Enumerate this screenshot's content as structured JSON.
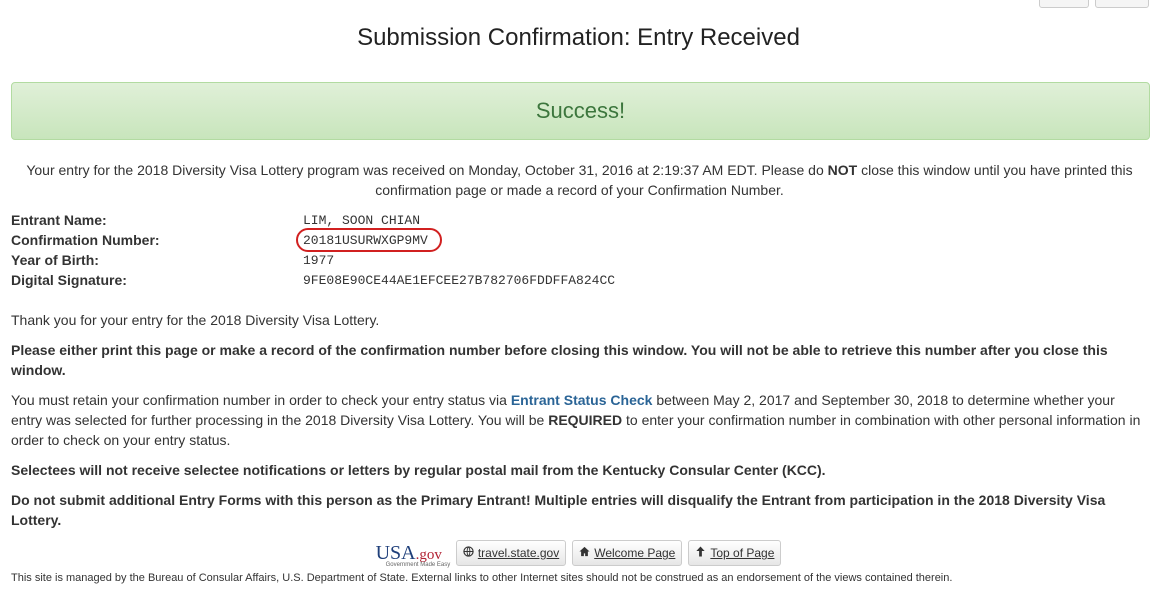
{
  "page": {
    "title": "Submission Confirmation: Entry Received"
  },
  "alert": {
    "text": "Success!"
  },
  "intro": {
    "part1": "Your entry for the 2018 Diversity Visa Lottery program was received on Monday, October 31, 2016 at 2:19:37 AM EDT. Please do ",
    "bold": "NOT",
    "part2": " close this window until you have printed this confirmation page or made a record of your Confirmation Number."
  },
  "info": {
    "entrant_name_label": "Entrant Name:",
    "entrant_name": "LIM, SOON CHIAN",
    "confirmation_label": "Confirmation Number:",
    "confirmation_number": "20181USURWXGP9MV",
    "birth_year_label": "Year of Birth:",
    "birth_year": "1977",
    "signature_label": "Digital Signature:",
    "signature": "9FE08E90CE44AE1EFCEE27B782706FDDFFA824CC"
  },
  "body": {
    "thanks": "Thank you for your entry for the 2018 Diversity Visa Lottery.",
    "print_notice": "Please either print this page or make a record of the confirmation number before closing this window. You will not be able to retrieve this number after you close this window.",
    "retain_part1": "You must retain your confirmation number in order to check your entry status via ",
    "retain_link": "Entrant Status Check",
    "retain_part2": " between May 2, 2017 and September 30, 2018 to determine whether your entry was selected for further processing in the 2018 Diversity Visa Lottery. You will be ",
    "retain_bold": "REQUIRED",
    "retain_part3": " to enter your confirmation number in combination with other personal information in order to check on your entry status.",
    "selectees": "Selectees will not receive selectee notifications or letters by regular postal mail from the Kentucky Consular Center (KCC).",
    "no_additional": "Do not submit additional Entry Forms with this person as the Primary Entrant! Multiple entries will disqualify the Entrant from participation in the 2018 Diversity Visa Lottery."
  },
  "footer": {
    "usa_logo": "USA",
    "usa_logo_gov": ".gov",
    "usa_logo_sub": "Government Made Easy",
    "travel_link": "travel.state.gov",
    "welcome_link": "Welcome Page",
    "top_link": "Top of Page",
    "disclaimer": "This site is managed by the Bureau of Consular Affairs, U.S. Department of State. External links to other Internet sites should not be construed as an endorsement of the views contained therein."
  },
  "colors": {
    "success_text": "#3c763d",
    "link": "#2a6496",
    "circle": "#d12020"
  },
  "icons": [
    "globe-icon",
    "home-icon",
    "arrow-up-icon"
  ]
}
